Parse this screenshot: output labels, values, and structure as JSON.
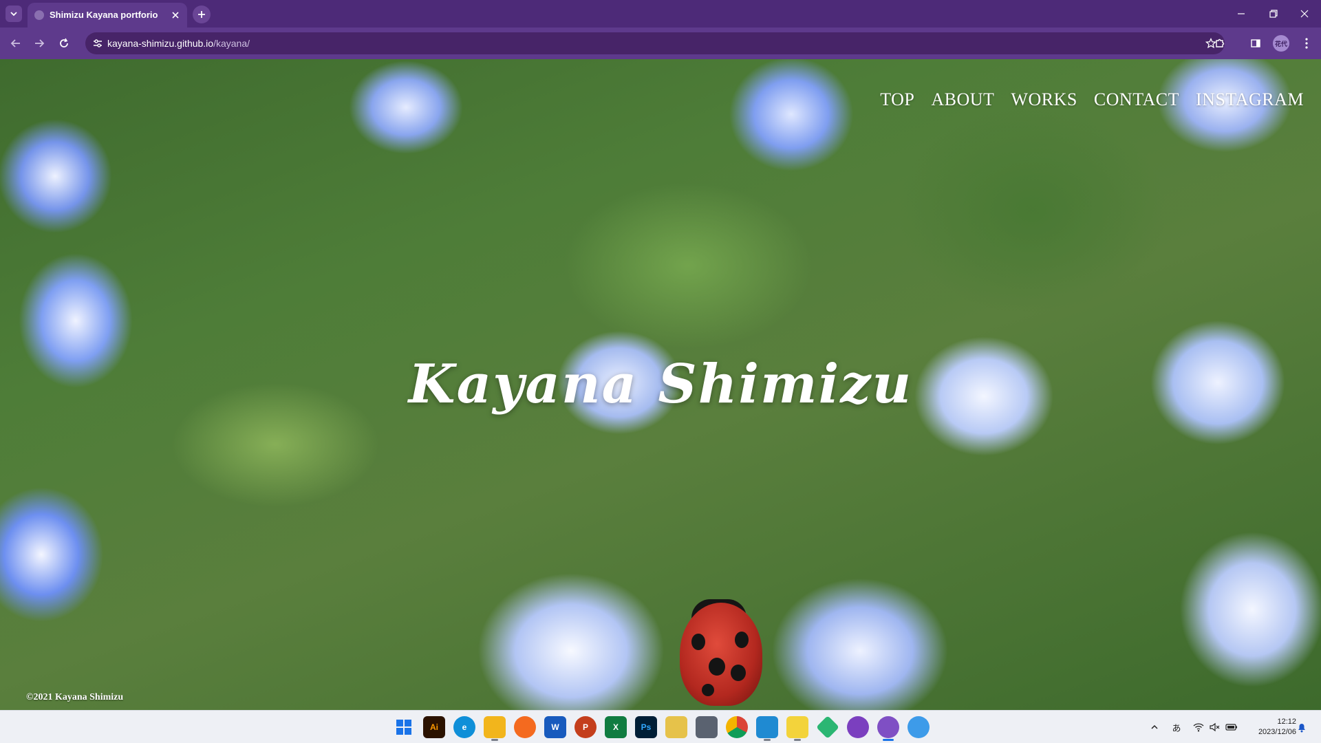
{
  "browser": {
    "tab_title": "Shimizu Kayana portforio",
    "url_host": "kayana-shimizu.github.io",
    "url_path": "/kayana/",
    "profile_initials": "花代"
  },
  "site": {
    "nav": [
      "TOP",
      "ABOUT",
      "WORKS",
      "CONTACT",
      "INSTAGRAM"
    ],
    "hero_title": "Kayana Shimizu",
    "copyright": "©2021 Kayana Shimizu"
  },
  "taskbar": {
    "apps": [
      {
        "name": "start-icon",
        "label": "",
        "color": "#1a73e8"
      },
      {
        "name": "illustrator-icon",
        "label": "Ai",
        "color": "#2b1200"
      },
      {
        "name": "edge-icon",
        "label": "e",
        "color": "#0f8fd8"
      },
      {
        "name": "file-explorer-icon",
        "label": "",
        "color": "#f2b51c"
      },
      {
        "name": "firefox-icon",
        "label": "",
        "color": "#f46a1f"
      },
      {
        "name": "word-icon",
        "label": "W",
        "color": "#185abd"
      },
      {
        "name": "powerpoint-icon",
        "label": "P",
        "color": "#c43e1c"
      },
      {
        "name": "excel-icon",
        "label": "X",
        "color": "#107c41"
      },
      {
        "name": "photoshop-icon",
        "label": "Ps",
        "color": "#001e36"
      },
      {
        "name": "paint-icon",
        "label": "",
        "color": "#e6c24a"
      },
      {
        "name": "calculator-icon",
        "label": "",
        "color": "#5a6270"
      },
      {
        "name": "chrome-icon",
        "label": "",
        "color": "#2f8c49"
      },
      {
        "name": "vscode-icon",
        "label": "",
        "color": "#1f8ad2"
      },
      {
        "name": "sticky-notes-icon",
        "label": "",
        "color": "#f3d33b"
      },
      {
        "name": "app-green-icon",
        "label": "",
        "color": "#2bb673"
      },
      {
        "name": "github-desktop-icon",
        "label": "",
        "color": "#7b3fbf"
      },
      {
        "name": "chrome-profile-icon",
        "label": "",
        "color": "#7f4fc4"
      },
      {
        "name": "app-blue-icon",
        "label": "",
        "color": "#3d9be9"
      }
    ],
    "ime": "あ",
    "time": "12:12",
    "date": "2023/12/06"
  }
}
